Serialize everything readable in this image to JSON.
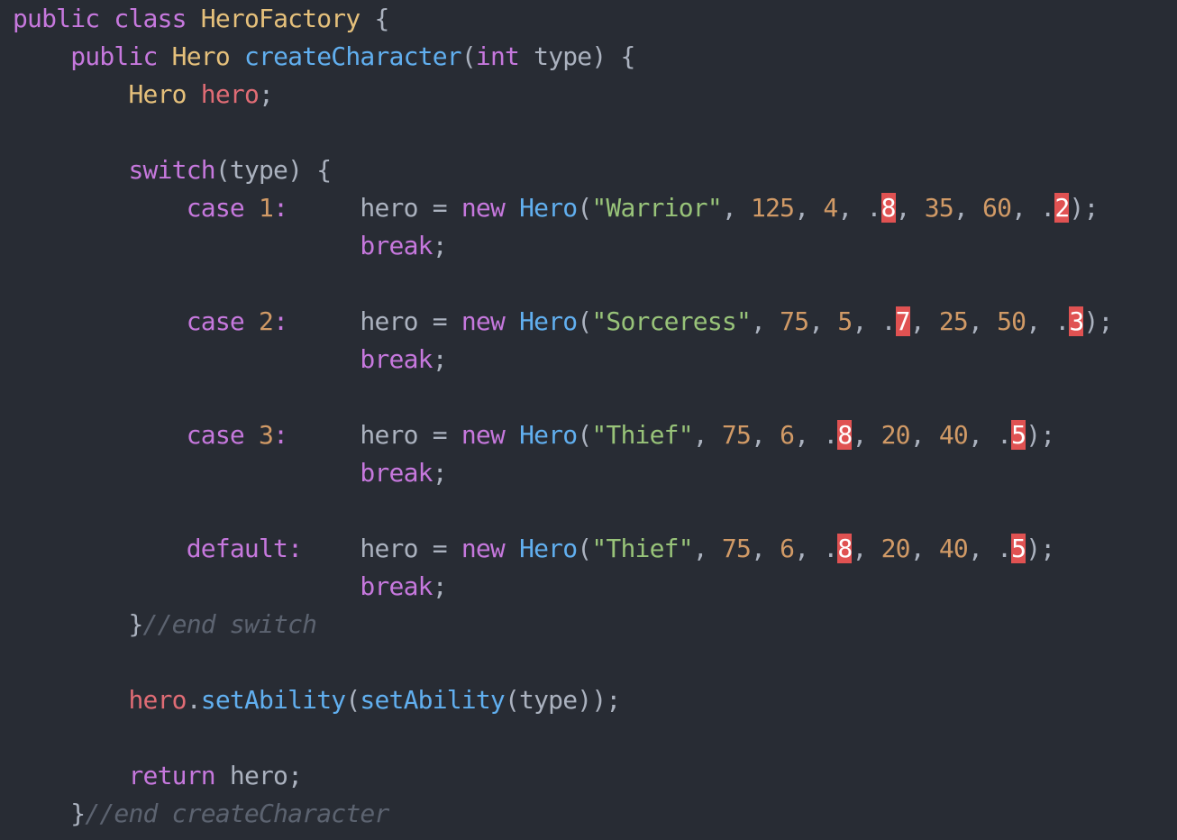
{
  "theme": {
    "background": "#282c34",
    "keyword": "#c678dd",
    "type": "#e5c07b",
    "function": "#61afef",
    "variable": "#e06c75",
    "number": "#d19a66",
    "string": "#98c379",
    "plain": "#abb2bf",
    "comment": "#5c6370",
    "error_background": "#e05252"
  },
  "lines": [
    {
      "indent": 0,
      "tokens": [
        {
          "t": "public",
          "k": "keyword"
        },
        {
          "t": " ",
          "k": "plain"
        },
        {
          "t": "class",
          "k": "keyword"
        },
        {
          "t": " ",
          "k": "plain"
        },
        {
          "t": "HeroFactory",
          "k": "type"
        },
        {
          "t": " {",
          "k": "plain"
        }
      ]
    },
    {
      "indent": 4,
      "tokens": [
        {
          "t": "public",
          "k": "keyword"
        },
        {
          "t": " ",
          "k": "plain"
        },
        {
          "t": "Hero",
          "k": "type"
        },
        {
          "t": " ",
          "k": "plain"
        },
        {
          "t": "createCharacter",
          "k": "function"
        },
        {
          "t": "(",
          "k": "plain"
        },
        {
          "t": "int",
          "k": "keyword"
        },
        {
          "t": " type) {",
          "k": "plain"
        }
      ]
    },
    {
      "indent": 8,
      "tokens": [
        {
          "t": "Hero",
          "k": "type"
        },
        {
          "t": " ",
          "k": "plain"
        },
        {
          "t": "hero",
          "k": "variable"
        },
        {
          "t": ";",
          "k": "plain"
        }
      ]
    },
    {
      "indent": 0,
      "tokens": []
    },
    {
      "indent": 8,
      "tokens": [
        {
          "t": "switch",
          "k": "keyword"
        },
        {
          "t": "(type) {",
          "k": "plain"
        }
      ]
    },
    {
      "indent": 12,
      "tokens": [
        {
          "t": "case",
          "k": "keyword"
        },
        {
          "t": " ",
          "k": "plain"
        },
        {
          "t": "1",
          "k": "number"
        },
        {
          "t": ":",
          "k": "keyword"
        },
        {
          "t": "     hero = ",
          "k": "plain"
        },
        {
          "t": "new",
          "k": "keyword"
        },
        {
          "t": " ",
          "k": "plain"
        },
        {
          "t": "Hero",
          "k": "function"
        },
        {
          "t": "(",
          "k": "plain"
        },
        {
          "t": "\"Warrior\"",
          "k": "string"
        },
        {
          "t": ", ",
          "k": "plain"
        },
        {
          "t": "125",
          "k": "number"
        },
        {
          "t": ", ",
          "k": "plain"
        },
        {
          "t": "4",
          "k": "number"
        },
        {
          "t": ", .",
          "k": "plain"
        },
        {
          "t": "8",
          "k": "error"
        },
        {
          "t": ", ",
          "k": "plain"
        },
        {
          "t": "35",
          "k": "number"
        },
        {
          "t": ", ",
          "k": "plain"
        },
        {
          "t": "60",
          "k": "number"
        },
        {
          "t": ", .",
          "k": "plain"
        },
        {
          "t": "2",
          "k": "error"
        },
        {
          "t": ");",
          "k": "plain"
        }
      ]
    },
    {
      "indent": 24,
      "tokens": [
        {
          "t": "break",
          "k": "keyword"
        },
        {
          "t": ";",
          "k": "plain"
        }
      ]
    },
    {
      "indent": 0,
      "tokens": []
    },
    {
      "indent": 12,
      "tokens": [
        {
          "t": "case",
          "k": "keyword"
        },
        {
          "t": " ",
          "k": "plain"
        },
        {
          "t": "2",
          "k": "number"
        },
        {
          "t": ":",
          "k": "keyword"
        },
        {
          "t": "     hero = ",
          "k": "plain"
        },
        {
          "t": "new",
          "k": "keyword"
        },
        {
          "t": " ",
          "k": "plain"
        },
        {
          "t": "Hero",
          "k": "function"
        },
        {
          "t": "(",
          "k": "plain"
        },
        {
          "t": "\"Sorceress\"",
          "k": "string"
        },
        {
          "t": ", ",
          "k": "plain"
        },
        {
          "t": "75",
          "k": "number"
        },
        {
          "t": ", ",
          "k": "plain"
        },
        {
          "t": "5",
          "k": "number"
        },
        {
          "t": ", .",
          "k": "plain"
        },
        {
          "t": "7",
          "k": "error"
        },
        {
          "t": ", ",
          "k": "plain"
        },
        {
          "t": "25",
          "k": "number"
        },
        {
          "t": ", ",
          "k": "plain"
        },
        {
          "t": "50",
          "k": "number"
        },
        {
          "t": ", .",
          "k": "plain"
        },
        {
          "t": "3",
          "k": "error"
        },
        {
          "t": ");",
          "k": "plain"
        }
      ]
    },
    {
      "indent": 24,
      "tokens": [
        {
          "t": "break",
          "k": "keyword"
        },
        {
          "t": ";",
          "k": "plain"
        }
      ]
    },
    {
      "indent": 0,
      "tokens": []
    },
    {
      "indent": 12,
      "tokens": [
        {
          "t": "case",
          "k": "keyword"
        },
        {
          "t": " ",
          "k": "plain"
        },
        {
          "t": "3",
          "k": "number"
        },
        {
          "t": ":",
          "k": "keyword"
        },
        {
          "t": "     hero = ",
          "k": "plain"
        },
        {
          "t": "new",
          "k": "keyword"
        },
        {
          "t": " ",
          "k": "plain"
        },
        {
          "t": "Hero",
          "k": "function"
        },
        {
          "t": "(",
          "k": "plain"
        },
        {
          "t": "\"Thief\"",
          "k": "string"
        },
        {
          "t": ", ",
          "k": "plain"
        },
        {
          "t": "75",
          "k": "number"
        },
        {
          "t": ", ",
          "k": "plain"
        },
        {
          "t": "6",
          "k": "number"
        },
        {
          "t": ", .",
          "k": "plain"
        },
        {
          "t": "8",
          "k": "error"
        },
        {
          "t": ", ",
          "k": "plain"
        },
        {
          "t": "20",
          "k": "number"
        },
        {
          "t": ", ",
          "k": "plain"
        },
        {
          "t": "40",
          "k": "number"
        },
        {
          "t": ", .",
          "k": "plain"
        },
        {
          "t": "5",
          "k": "error"
        },
        {
          "t": ");",
          "k": "plain"
        }
      ]
    },
    {
      "indent": 24,
      "tokens": [
        {
          "t": "break",
          "k": "keyword"
        },
        {
          "t": ";",
          "k": "plain"
        }
      ]
    },
    {
      "indent": 0,
      "tokens": []
    },
    {
      "indent": 12,
      "tokens": [
        {
          "t": "default:",
          "k": "keyword"
        },
        {
          "t": "    hero = ",
          "k": "plain"
        },
        {
          "t": "new",
          "k": "keyword"
        },
        {
          "t": " ",
          "k": "plain"
        },
        {
          "t": "Hero",
          "k": "function"
        },
        {
          "t": "(",
          "k": "plain"
        },
        {
          "t": "\"Thief\"",
          "k": "string"
        },
        {
          "t": ", ",
          "k": "plain"
        },
        {
          "t": "75",
          "k": "number"
        },
        {
          "t": ", ",
          "k": "plain"
        },
        {
          "t": "6",
          "k": "number"
        },
        {
          "t": ", .",
          "k": "plain"
        },
        {
          "t": "8",
          "k": "error"
        },
        {
          "t": ", ",
          "k": "plain"
        },
        {
          "t": "20",
          "k": "number"
        },
        {
          "t": ", ",
          "k": "plain"
        },
        {
          "t": "40",
          "k": "number"
        },
        {
          "t": ", .",
          "k": "plain"
        },
        {
          "t": "5",
          "k": "error"
        },
        {
          "t": ");",
          "k": "plain"
        }
      ]
    },
    {
      "indent": 24,
      "tokens": [
        {
          "t": "break",
          "k": "keyword"
        },
        {
          "t": ";",
          "k": "plain"
        }
      ]
    },
    {
      "indent": 8,
      "tokens": [
        {
          "t": "}",
          "k": "plain"
        },
        {
          "t": "//end switch",
          "k": "comment"
        }
      ]
    },
    {
      "indent": 0,
      "tokens": []
    },
    {
      "indent": 8,
      "tokens": [
        {
          "t": "hero",
          "k": "variable"
        },
        {
          "t": ".",
          "k": "plain"
        },
        {
          "t": "setAbility",
          "k": "function"
        },
        {
          "t": "(",
          "k": "plain"
        },
        {
          "t": "setAbility",
          "k": "function"
        },
        {
          "t": "(type));",
          "k": "plain"
        }
      ]
    },
    {
      "indent": 0,
      "tokens": []
    },
    {
      "indent": 8,
      "tokens": [
        {
          "t": "return",
          "k": "keyword"
        },
        {
          "t": " hero;",
          "k": "plain"
        }
      ]
    },
    {
      "indent": 4,
      "tokens": [
        {
          "t": "}",
          "k": "plain"
        },
        {
          "t": "//end createCharacter",
          "k": "comment"
        }
      ]
    }
  ]
}
